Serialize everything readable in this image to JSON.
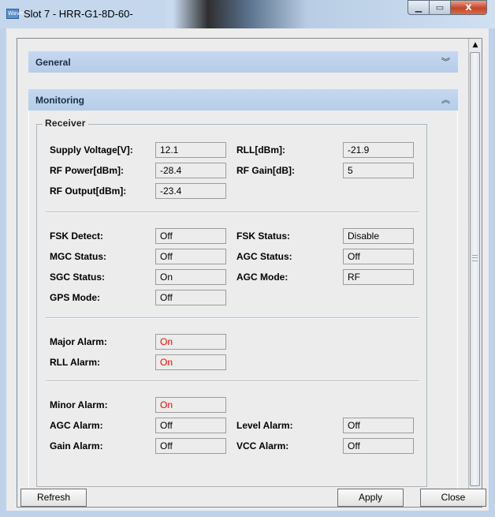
{
  "window": {
    "title": "Slot 7 - HRR-G1-8D-60-",
    "app_icon_text": "Wave",
    "controls": [
      "minimize-icon",
      "maximize-icon",
      "close-icon"
    ],
    "close_glyph": "x"
  },
  "panels": {
    "general": {
      "title": "General",
      "expanded": false
    },
    "monitoring": {
      "title": "Monitoring",
      "expanded": true
    }
  },
  "receiver": {
    "legend": "Receiver",
    "supply_voltage": {
      "label": "Supply Voltage[V]:",
      "value": "12.1"
    },
    "rll": {
      "label": "RLL[dBm]:",
      "value": "-21.9"
    },
    "rf_power": {
      "label": "RF Power[dBm]:",
      "value": "-28.4"
    },
    "rf_gain": {
      "label": "RF Gain[dB]:",
      "value": "5"
    },
    "rf_output": {
      "label": "RF Output[dBm]:",
      "value": "-23.4"
    },
    "fsk_detect": {
      "label": "FSK Detect:",
      "value": "Off"
    },
    "fsk_status": {
      "label": "FSK Status:",
      "value": "Disable"
    },
    "mgc_status": {
      "label": "MGC Status:",
      "value": "Off"
    },
    "agc_status": {
      "label": "AGC Status:",
      "value": "Off"
    },
    "sgc_status": {
      "label": "SGC Status:",
      "value": "On"
    },
    "agc_mode": {
      "label": "AGC Mode:",
      "value": "RF"
    },
    "gps_mode": {
      "label": "GPS Mode:",
      "value": "Off"
    },
    "major_alarm": {
      "label": "Major Alarm:",
      "value": "On"
    },
    "rll_alarm": {
      "label": "RLL Alarm:",
      "value": "On"
    },
    "minor_alarm": {
      "label": "Minor Alarm:",
      "value": "On"
    },
    "agc_alarm": {
      "label": "AGC Alarm:",
      "value": "Off"
    },
    "level_alarm": {
      "label": "Level Alarm:",
      "value": "Off"
    },
    "gain_alarm": {
      "label": "Gain Alarm:",
      "value": "Off"
    },
    "vcc_alarm": {
      "label": "VCC Alarm:",
      "value": "Off"
    }
  },
  "colors": {
    "alarm_on": "#ff0000",
    "panel_header": "#b6cde8"
  },
  "buttons": {
    "refresh": "Refresh",
    "apply": "Apply",
    "close": "Close"
  }
}
